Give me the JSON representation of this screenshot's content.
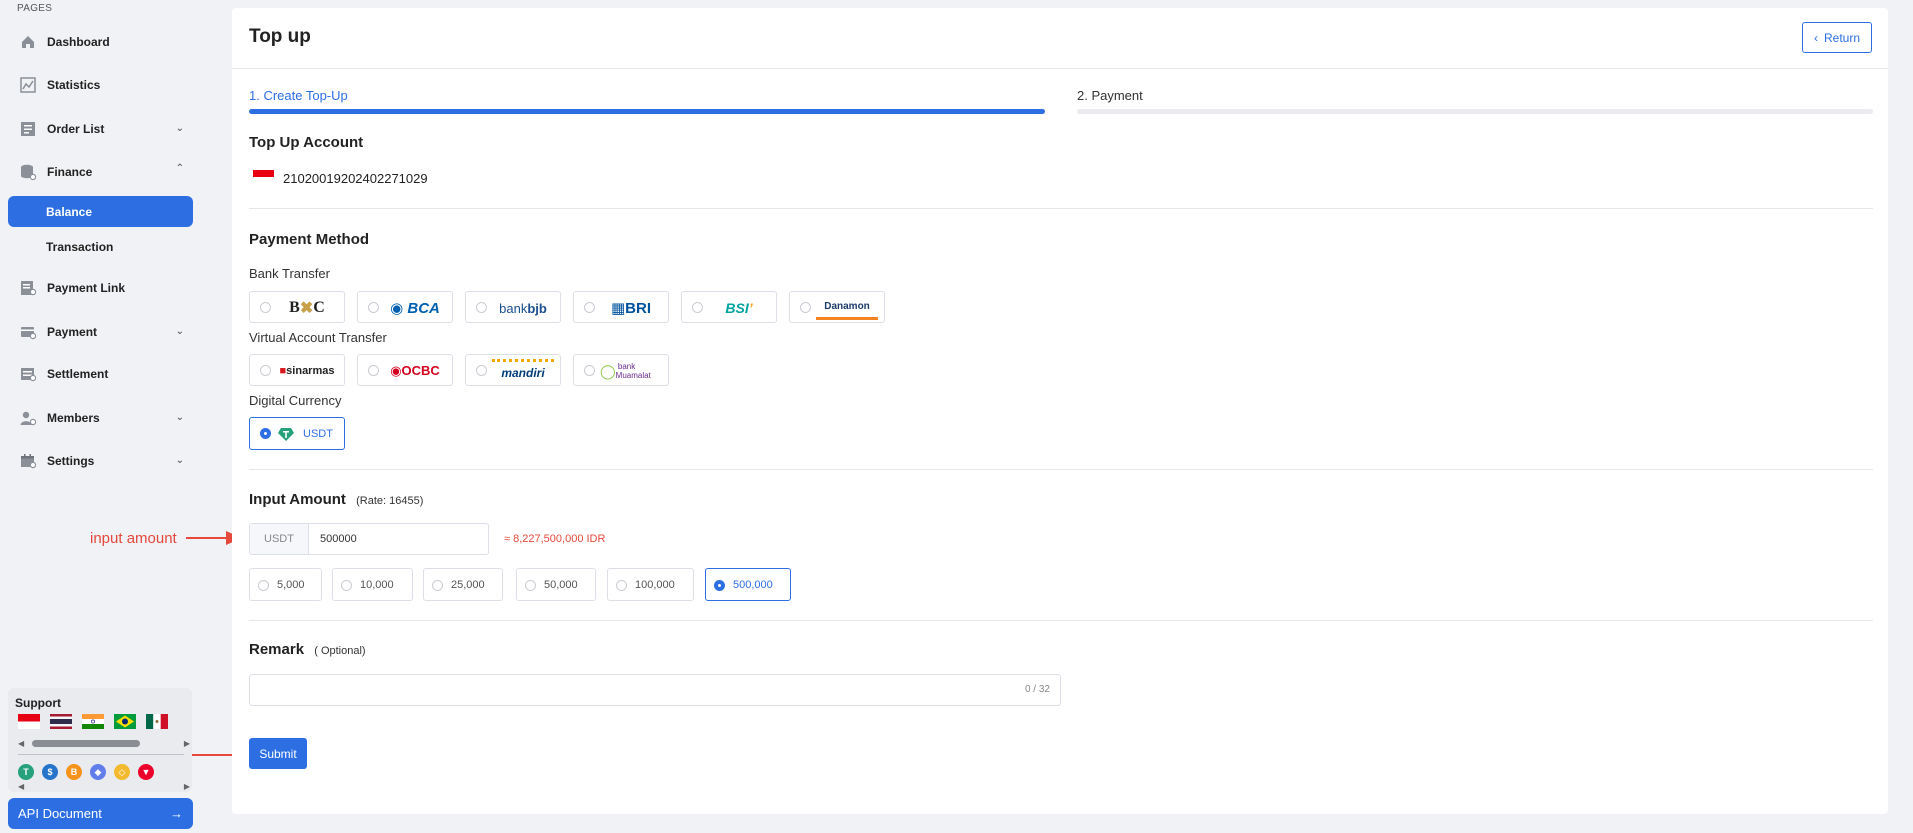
{
  "sidebar": {
    "section_label": "PAGES",
    "items": [
      {
        "label": "Dashboard",
        "icon": "home-icon"
      },
      {
        "label": "Statistics",
        "icon": "chart-icon"
      },
      {
        "label": "Order List",
        "icon": "list-icon",
        "expandable": true
      },
      {
        "label": "Finance",
        "icon": "database-icon",
        "expanded": true
      },
      {
        "label": "Payment Link",
        "icon": "link-icon"
      },
      {
        "label": "Payment",
        "icon": "payment-icon",
        "expandable": true
      },
      {
        "label": "Settlement",
        "icon": "settlement-icon"
      },
      {
        "label": "Members",
        "icon": "members-icon",
        "expandable": true
      },
      {
        "label": "Settings",
        "icon": "settings-icon",
        "expandable": true
      }
    ],
    "finance_sub": [
      {
        "label": "Balance",
        "active": true
      },
      {
        "label": "Transaction",
        "active": false
      }
    ],
    "support": {
      "title": "Support",
      "flags": [
        "indonesia",
        "thailand",
        "india",
        "brazil",
        "mexico"
      ],
      "coins": [
        "usdt",
        "usdc",
        "btc",
        "eth",
        "bnb",
        "trx"
      ]
    },
    "api_button": "API Document"
  },
  "annotations": {
    "input_amount": "input amount"
  },
  "page": {
    "title": "Top up",
    "return_label": "Return",
    "steps": [
      {
        "label": "1. Create Top-Up",
        "active": true
      },
      {
        "label": "2. Payment",
        "active": false
      }
    ],
    "account": {
      "title": "Top Up Account",
      "number": "21020019202402271029"
    },
    "payment_method": {
      "title": "Payment Method",
      "bank_transfer_label": "Bank Transfer",
      "bank_transfer": [
        "BNC",
        "BCA",
        "bank bjb",
        "BRI",
        "BSI",
        "Danamon"
      ],
      "va_label": "Virtual Account Transfer",
      "va": [
        "sinarmas",
        "OCBC",
        "mandiri",
        "bank Muamalat"
      ],
      "digital_label": "Digital Currency",
      "digital": [
        {
          "label": "USDT",
          "selected": true
        }
      ]
    },
    "input_amount": {
      "title": "Input Amount",
      "rate": "(Rate: 16455)",
      "currency": "USDT",
      "value": "500000",
      "converted": "≈ 8,227,500,000 IDR",
      "quick_options": [
        "5,000",
        "10,000",
        "25,000",
        "50,000",
        "100,000",
        "500,000"
      ],
      "selected_option": "500,000"
    },
    "remark": {
      "title": "Remark",
      "optional": "( Optional)",
      "counter": "0 / 32"
    },
    "submit_label": "Submit"
  },
  "colors": {
    "primary": "#2d6fe3",
    "annotation": "#e4493c"
  }
}
